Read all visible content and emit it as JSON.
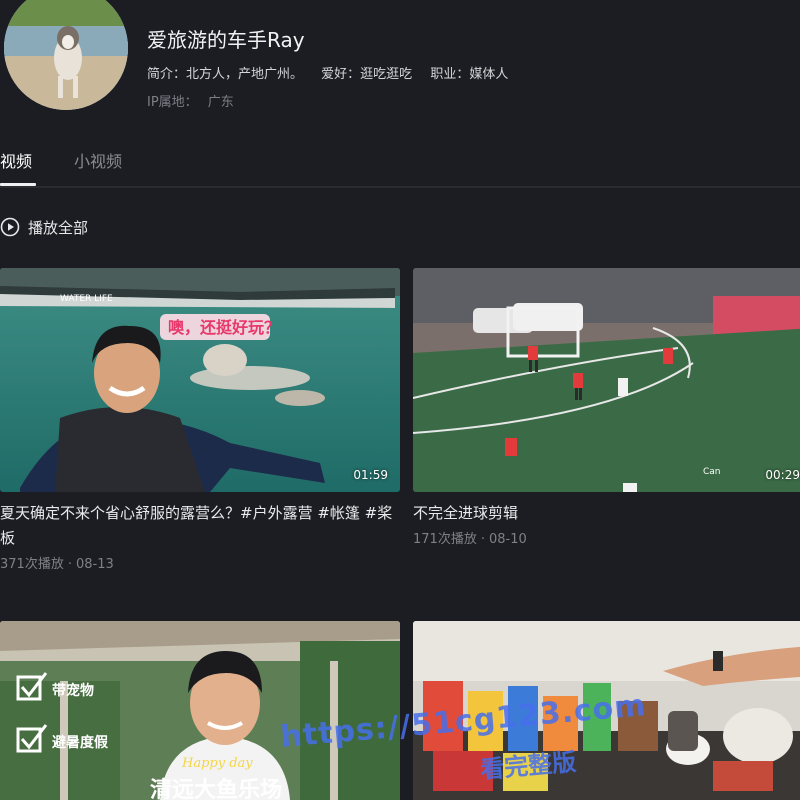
{
  "profile": {
    "name": "爱旅游的车手Ray",
    "bio": [
      "简介：北方人，产地广州。",
      "爱好：逛吃逛吃",
      "职业：媒体人"
    ],
    "ip_label": "IP属地：",
    "ip_value": "广东"
  },
  "tabs": [
    {
      "label": "视频",
      "active": true
    },
    {
      "label": "小视频",
      "active": false
    }
  ],
  "play_all": "播放全部",
  "videos": [
    {
      "title": "夏天确定不来个省心舒服的露营么？#户外露营 #帐篷 #桨板",
      "views": "371次播放",
      "date": "08-13",
      "duration": "01:59",
      "overlay_text": "噢，还挺好玩？",
      "sign_text": "WATER LIFE"
    },
    {
      "title": "不完全进球剪辑",
      "views": "171次播放",
      "date": "08-10",
      "duration": "00:29",
      "overlay_text": "Can"
    },
    {
      "title": "",
      "overlay_lines": [
        "带宠物",
        "避暑度假"
      ],
      "overlay_script": "Happy day",
      "overlay_big": "清远大鱼乐场"
    },
    {
      "title": ""
    }
  ],
  "watermark": {
    "url": "https://51cg123.com",
    "sub": "看完整版"
  },
  "colors": {
    "background": "#1c1d22",
    "text_primary": "#f2f2f4",
    "text_secondary": "#7d7e86",
    "watermark": "#466eeb"
  }
}
